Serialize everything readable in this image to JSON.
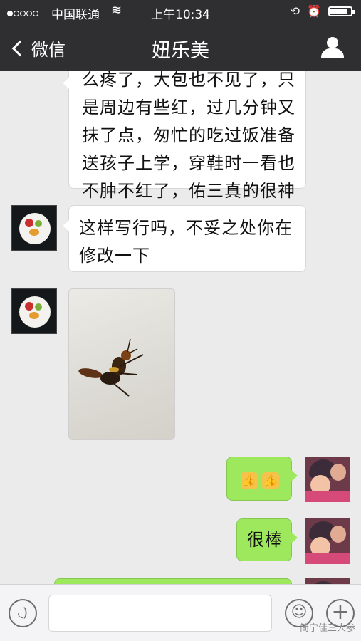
{
  "status_bar": {
    "carrier": "中国联通",
    "time": "上午10:34",
    "battery_level": 0.85
  },
  "nav": {
    "back_label": "微信",
    "title": "妞乐美"
  },
  "messages": [
    {
      "side": "left",
      "type": "text",
      "lines": [
        "么疼了，大包也不见了，只",
        "是周边有些红，过几分钟又",
        "抹了点，匆忙的吃过饭准备",
        "送孩子上学，穿鞋时一看也",
        "不肿不红了，佑三真的很神"
      ]
    },
    {
      "side": "left",
      "type": "text",
      "lines": [
        "这样写行吗，不妥之处你在",
        "修改一下"
      ]
    },
    {
      "side": "left",
      "type": "image",
      "icon": "wasp-photo"
    },
    {
      "side": "right",
      "type": "emoji",
      "icons": [
        "thumbs-up-icon",
        "thumbs-up-icon"
      ]
    },
    {
      "side": "right",
      "type": "text",
      "lines": [
        "很棒"
      ]
    }
  ],
  "input": {
    "watermark": "简宁佳三人参"
  },
  "colors": {
    "nav_bg": "#2f2f31",
    "chat_bg": "#ebebeb",
    "sent_bubble": "#9ee85e",
    "received_bubble": "#ffffff"
  }
}
